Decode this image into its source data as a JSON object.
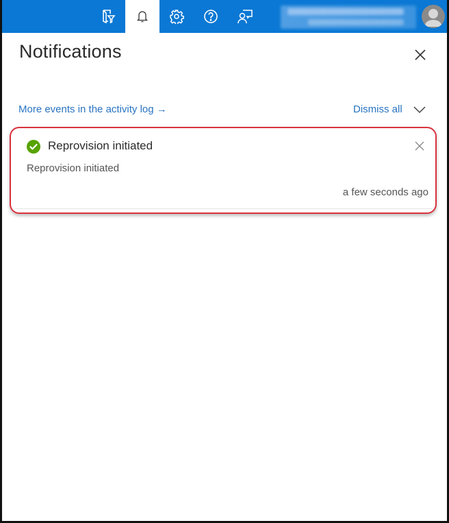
{
  "topbar": {
    "icons": [
      {
        "name": "directory-filter-icon",
        "active": false
      },
      {
        "name": "notifications-bell-icon",
        "active": true
      },
      {
        "name": "settings-gear-icon",
        "active": false
      },
      {
        "name": "help-question-icon",
        "active": false
      },
      {
        "name": "feedback-icon",
        "active": false
      }
    ],
    "account": "blurred-account-info",
    "avatar_icon": "user-avatar-icon",
    "brand_color": "#0a78d4"
  },
  "panel": {
    "title": "Notifications",
    "close_icon": "close-icon",
    "activity_link": "More events in the activity log →",
    "dismiss_all": "Dismiss all",
    "dismiss_chevron_icon": "chevron-down-icon",
    "link_color": "#2a74c2"
  },
  "notifications": [
    {
      "status": "success",
      "status_color": "#57a300",
      "title": "Reprovision initiated",
      "body": "Reprovision initiated",
      "time": "a few seconds ago",
      "highlight_color": "#d9323e"
    }
  ]
}
